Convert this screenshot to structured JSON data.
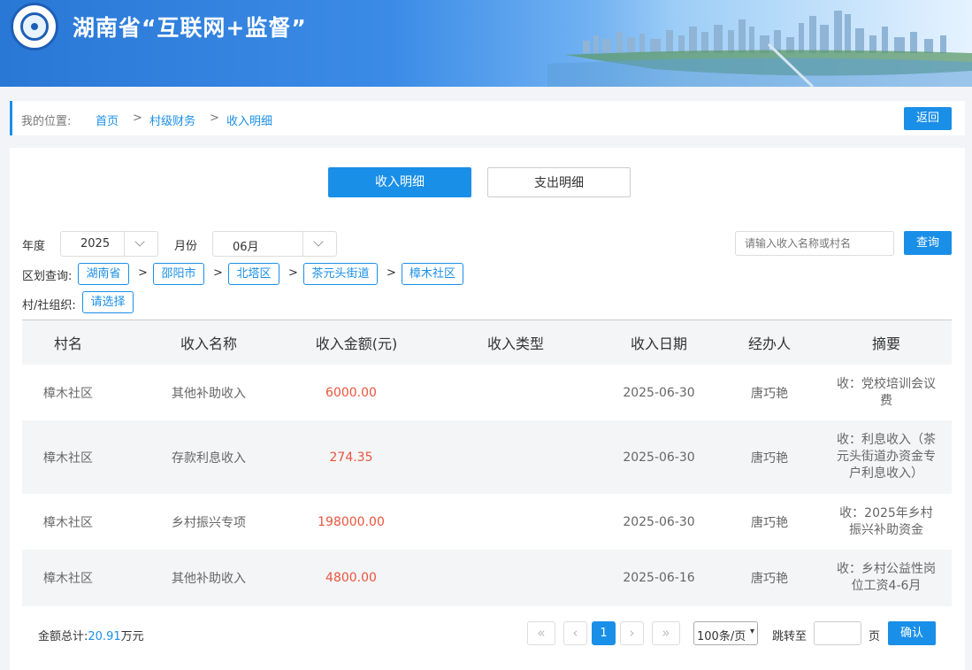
{
  "header": {
    "title": "湖南省“互联网+监督”"
  },
  "breadcrumb": {
    "label": "我的位置:",
    "items": [
      "首页",
      "村级财务",
      "收入明细"
    ],
    "sep": ">",
    "back_label": "返回"
  },
  "tabs": [
    {
      "label": "收入明细",
      "active": true
    },
    {
      "label": "支出明细",
      "active": false
    }
  ],
  "filters": {
    "year_label": "年度",
    "year_value": "2025",
    "month_label": "月份",
    "month_value": "06月",
    "search_placeholder": "请输入收入名称或村名",
    "query_label": "查询",
    "region_label": "区划查询:",
    "regions": [
      "湖南省",
      "邵阳市",
      "北塔区",
      "茶元头街道",
      "樟木社区"
    ],
    "region_sep": ">",
    "org_label": "村/社组织:",
    "org_value": "请选择"
  },
  "table": {
    "headers": [
      "村名",
      "收入名称",
      "收入金额(元)",
      "收入类型",
      "收入日期",
      "经办人",
      "摘要"
    ],
    "rows": [
      {
        "village": "樟木社区",
        "name": "其他补助收入",
        "amount": "6000.00",
        "type": "",
        "date": "2025-06-30",
        "handler": "唐巧艳",
        "memo": "收：党校培训会议费"
      },
      {
        "village": "樟木社区",
        "name": "存款利息收入",
        "amount": "274.35",
        "type": "",
        "date": "2025-06-30",
        "handler": "唐巧艳",
        "memo": "收：利息收入（茶元头街道办资金专户利息收入）"
      },
      {
        "village": "樟木社区",
        "name": "乡村振兴专项",
        "amount": "198000.00",
        "type": "",
        "date": "2025-06-30",
        "handler": "唐巧艳",
        "memo": "收：2025年乡村振兴补助资金"
      },
      {
        "village": "樟木社区",
        "name": "其他补助收入",
        "amount": "4800.00",
        "type": "",
        "date": "2025-06-16",
        "handler": "唐巧艳",
        "memo": "收：乡村公益性岗位工资4-6月"
      }
    ]
  },
  "footer": {
    "total_label": "金额总计:",
    "total_value": "20.91",
    "total_unit": "万元",
    "first": "«",
    "prev": "‹",
    "current_page": "1",
    "next": "›",
    "last": "»",
    "page_size": "100条/页",
    "jump_label": "跳转至",
    "page_unit": "页",
    "confirm_label": "确认"
  }
}
